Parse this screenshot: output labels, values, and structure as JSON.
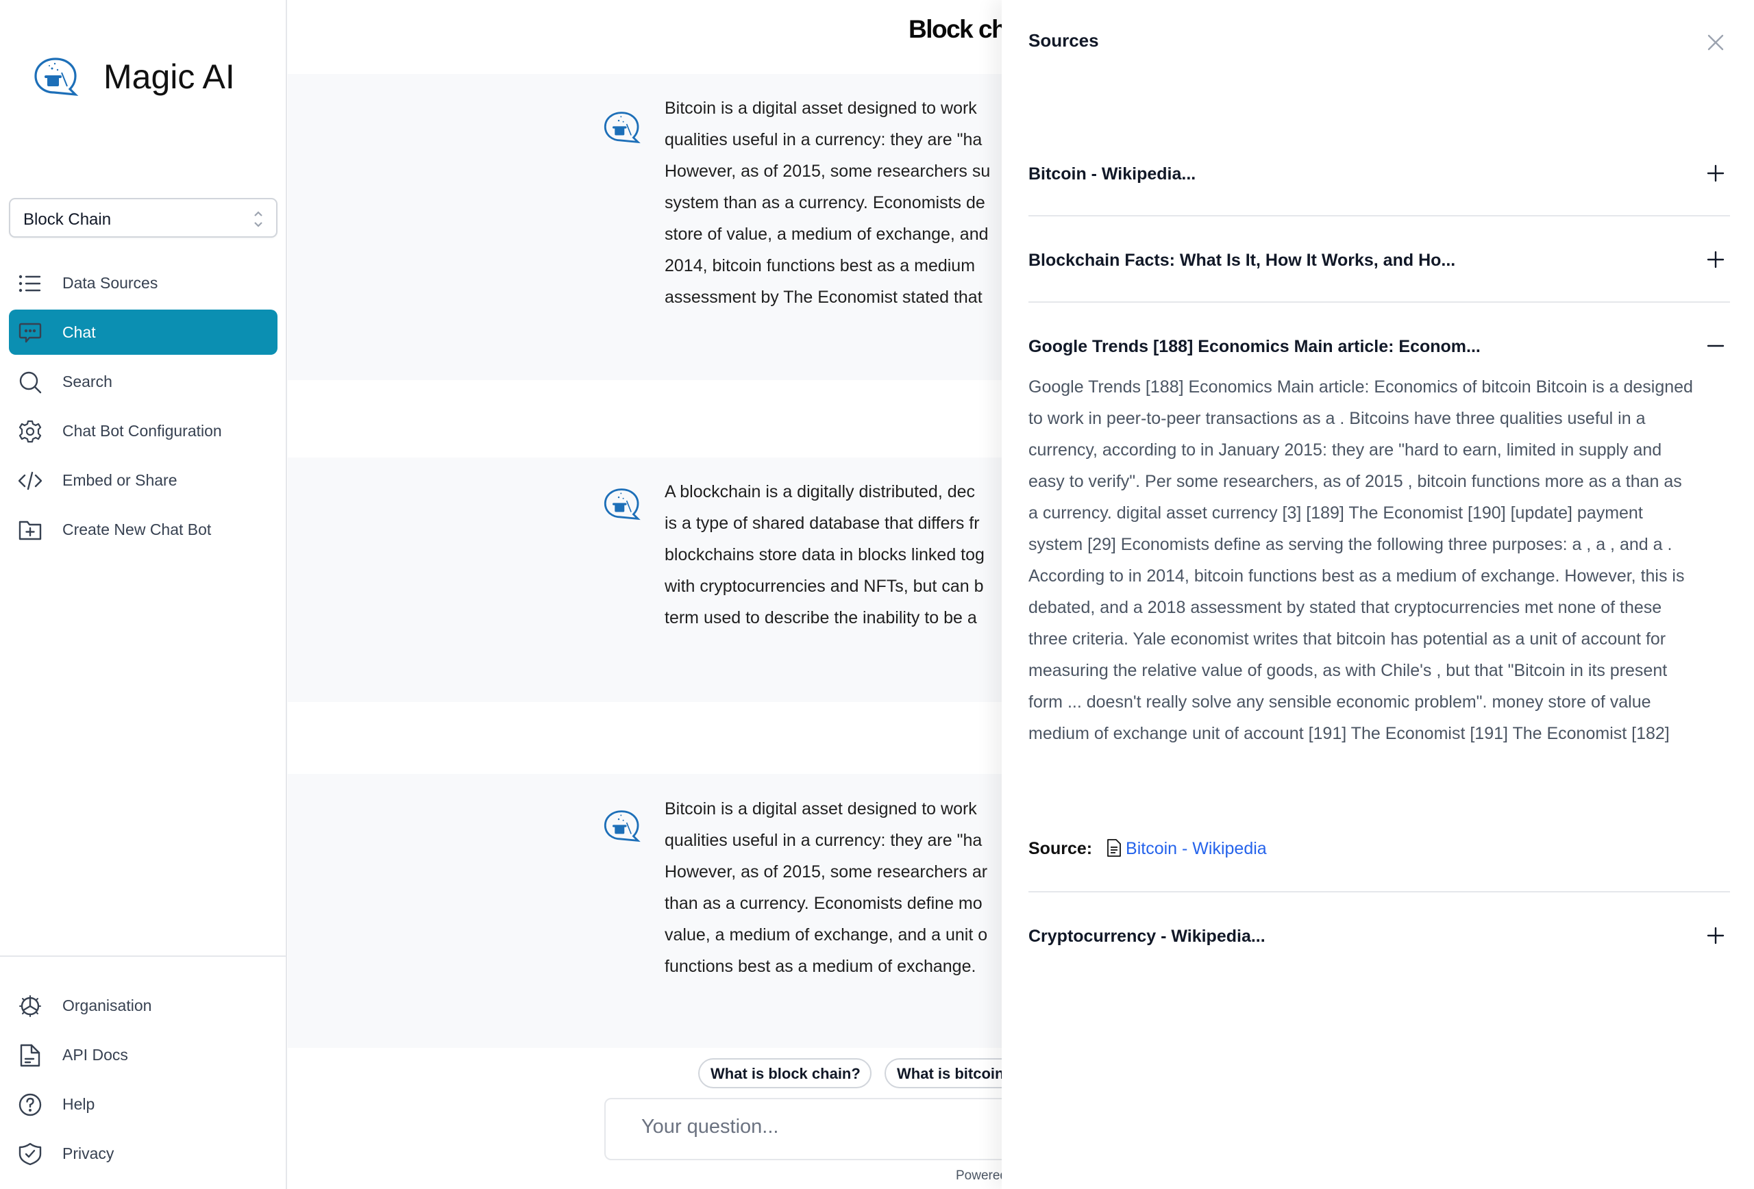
{
  "app": {
    "name": "Magic AI",
    "accent": "#0b8fb2",
    "logo_icon": "magic-hat-chat-icon"
  },
  "sidebar": {
    "bot_select": {
      "value": "Block Chain"
    },
    "items": [
      {
        "label": "Data Sources",
        "icon": "list-icon"
      },
      {
        "label": "Chat",
        "icon": "chat-bubble-icon",
        "active": true
      },
      {
        "label": "Search",
        "icon": "search-icon"
      },
      {
        "label": "Chat Bot Configuration",
        "icon": "gear-icon"
      },
      {
        "label": "Embed or Share",
        "icon": "code-icon"
      },
      {
        "label": "Create New Chat Bot",
        "icon": "folder-plus-icon"
      }
    ],
    "bottom_items": [
      {
        "label": "Organisation",
        "icon": "organisation-icon"
      },
      {
        "label": "API Docs",
        "icon": "document-icon"
      },
      {
        "label": "Help",
        "icon": "help-circle-icon"
      },
      {
        "label": "Privacy",
        "icon": "shield-check-icon"
      }
    ]
  },
  "chat": {
    "title": "Block chain",
    "messages": [
      {
        "lines": [
          "Bitcoin is a digital asset designed to work",
          "qualities useful in a currency: they are \"ha",
          "However, as of 2015, some researchers su",
          "system than as a currency. Economists de",
          "store of value, a medium of exchange, and",
          "2014, bitcoin functions best as a medium",
          "assessment by The Economist stated that"
        ]
      },
      {
        "lines": [
          "A blockchain is a digitally distributed, dec",
          "is a type of shared database that differs fr",
          "blockchains store data in blocks linked tog",
          "with cryptocurrencies and NFTs, but can b",
          "term used to describe the inability to be a"
        ]
      },
      {
        "lines": [
          "Bitcoin is a digital asset designed to work",
          "qualities useful in a currency: they are \"ha",
          "However, as of 2015, some researchers ar",
          "than as a currency. Economists define mo",
          "value, a medium of exchange, and a unit o",
          "functions best as a medium of exchange."
        ]
      }
    ],
    "suggestions": [
      "What is block chain?",
      "What is bitcoin?"
    ],
    "input": {
      "placeholder": "Your question...",
      "value": ""
    },
    "powered_by": "Powered"
  },
  "sources_panel": {
    "title": "Sources",
    "items": [
      {
        "title": "Bitcoin - Wikipedia...",
        "expanded": false
      },
      {
        "title": "Blockchain Facts: What Is It, How It Works, and Ho...",
        "expanded": false
      },
      {
        "title": "Google Trends [188] Economics Main article: Econom...",
        "expanded": true,
        "body": "Google Trends [188] Economics Main article: Economics of bitcoin Bitcoin is a designed to work in peer-to-peer transactions as a . Bitcoins have three qualities useful in a currency, according to in January 2015: they are \"hard to earn, limited in supply and easy to verify\". Per some researchers, as of 2015 , bitcoin functions more as a than as a currency. digital asset currency [3] [189] The Economist [190] [update] payment system [29] Economists define as serving the following three purposes: a , a , and a . According to in 2014, bitcoin functions best as a medium of exchange. However, this is debated, and a 2018 assessment by stated that cryptocurrencies met none of these three criteria. Yale economist writes that bitcoin has potential as a unit of account for measuring the relative value of goods, as with Chile's , but that \"Bitcoin in its present form ... doesn't really solve any sensible economic problem\". money store of value medium of exchange unit of account [191] The Economist [191] The Economist [182]",
        "source_label": "Source:",
        "source_link": "Bitcoin - Wikipedia"
      },
      {
        "title": "Cryptocurrency - Wikipedia...",
        "expanded": false
      }
    ]
  }
}
